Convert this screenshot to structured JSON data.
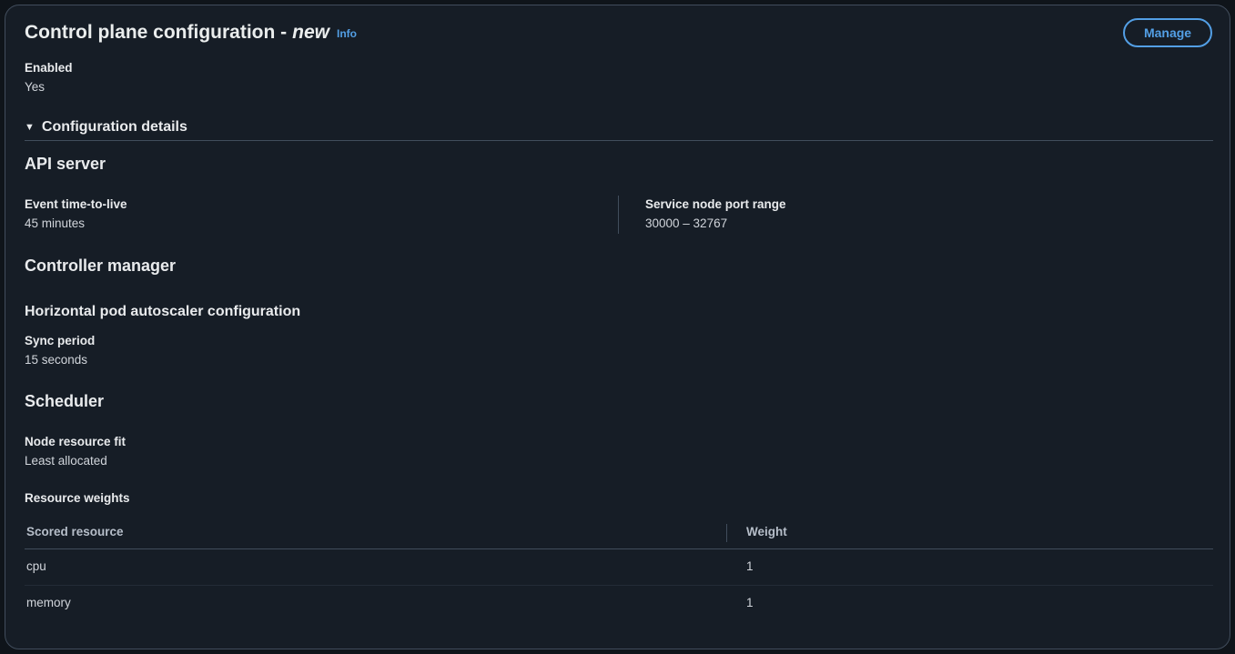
{
  "header": {
    "title": "Control plane configuration -",
    "title_suffix": "new",
    "info_label": "Info",
    "manage_label": "Manage"
  },
  "enabled": {
    "label": "Enabled",
    "value": "Yes"
  },
  "config_details": {
    "label": "Configuration details",
    "expanded": true
  },
  "api_server": {
    "heading": "API server",
    "event_ttl": {
      "label": "Event time-to-live",
      "value": "45 minutes"
    },
    "service_port_range": {
      "label": "Service node port range",
      "value": "30000 – 32767"
    }
  },
  "controller_manager": {
    "heading": "Controller manager",
    "hpa_heading": "Horizontal pod autoscaler configuration",
    "sync_period": {
      "label": "Sync period",
      "value": "15 seconds"
    }
  },
  "scheduler": {
    "heading": "Scheduler",
    "node_fit": {
      "label": "Node resource fit",
      "value": "Least allocated"
    },
    "weights_label": "Resource weights",
    "table": {
      "columns": [
        "Scored resource",
        "Weight"
      ],
      "rows": [
        [
          "cpu",
          "1"
        ],
        [
          "memory",
          "1"
        ]
      ]
    }
  },
  "colors": {
    "accent": "#539fe5",
    "panel_bg": "#161d26",
    "border": "#414d5c"
  }
}
